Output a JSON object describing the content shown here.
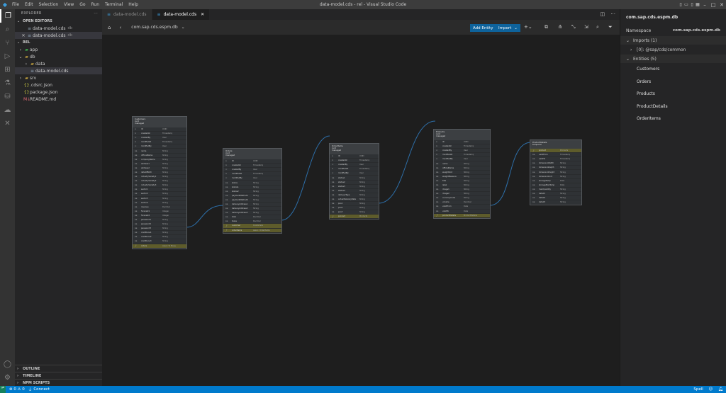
{
  "titlebar": {
    "menu": [
      "File",
      "Edit",
      "Selection",
      "View",
      "Go",
      "Run",
      "Terminal",
      "Help"
    ],
    "title": "data-model.cds - rel - Visual Studio Code"
  },
  "explorer": {
    "title": "EXPLORER",
    "open_editors": {
      "label": "OPEN EDITORS",
      "items": [
        {
          "name": "data-model.cds",
          "dir": "db"
        },
        {
          "name": "data-model.cds",
          "dir": "db"
        }
      ]
    },
    "workspace": {
      "label": "REL",
      "tree": [
        "app",
        "db",
        "data",
        "data-model.cds",
        "srv",
        ".cdsrc.json",
        "package.json",
        "README.md"
      ]
    },
    "bottom_sections": [
      "OUTLINE",
      "TIMELINE",
      "NPM SCRIPTS"
    ]
  },
  "tabs": [
    {
      "label": "data-model.cds",
      "active": false
    },
    {
      "label": "data-model.cds",
      "active": true
    }
  ],
  "toolbar": {
    "namespace": "com.sap.cds.espm.db",
    "add_entity": "Add Entity",
    "import": "Import"
  },
  "entities": [
    {
      "title": [
        "Customers",
        "cuid",
        "managed"
      ],
      "fields": [
        [
          "ID",
          "UUID"
        ],
        [
          "createdAt",
          "Timestamp"
        ],
        [
          "createdBy",
          "User"
        ],
        [
          "modifiedAt",
          "Timestamp"
        ],
        [
          "modifiedBy",
          "User"
        ],
        [
          "name",
          "String"
        ],
        [
          "officialName",
          "String"
        ],
        [
          "companyName",
          "String"
        ],
        [
          "address1",
          "String"
        ],
        [
          "address2",
          "String"
        ],
        [
          "dateOfBirth",
          "String"
        ],
        [
          "industryVariety1",
          "String"
        ],
        [
          "industryVariety2",
          "String"
        ],
        [
          "industryVariety3",
          "String"
        ],
        [
          "sector1",
          "String"
        ],
        [
          "sector2",
          "String"
        ],
        [
          "sector3",
          "String"
        ],
        [
          "sector4",
          "String"
        ],
        [
          "revenue",
          "Decimal"
        ],
        [
          "forecast1",
          "Integer"
        ],
        [
          "forecast2",
          "Integer"
        ],
        [
          "password1",
          "String"
        ],
        [
          "password2",
          "String"
        ],
        [
          "password3",
          "String"
        ],
        [
          "creditLine1",
          "String"
        ],
        [
          "creditLine2",
          "String"
        ],
        [
          "creditLine3",
          "String"
        ],
        [
          "orders",
          "Assoc.To Many"
        ]
      ]
    },
    {
      "title": [
        "Orders",
        "cuid",
        "managed"
      ],
      "fields": [
        [
          "ID",
          "UUID"
        ],
        [
          "createdAt",
          "Timestamp"
        ],
        [
          "createdBy",
          "User"
        ],
        [
          "modifiedAt",
          "Timestamp"
        ],
        [
          "modifiedBy",
          "User"
        ],
        [
          "status",
          "String"
        ],
        [
          "status1",
          "String"
        ],
        [
          "status2",
          "String"
        ],
        [
          "paymentMethod1",
          "String"
        ],
        [
          "paymentMethod2",
          "String"
        ],
        [
          "deliveryAddress1",
          "String"
        ],
        [
          "deliveryAddress2",
          "String"
        ],
        [
          "deliveryAddress3",
          "String"
        ],
        [
          "total",
          "Decimal"
        ],
        [
          "taxes",
          "Decimal"
        ],
        [
          "customer",
          "Customers"
        ],
        [
          "orderItems",
          "assoc. OrderItems"
        ]
      ]
    },
    {
      "title": [
        "OrderItems",
        "cuid",
        "managed"
      ],
      "fields": [
        [
          "ID",
          "UUID"
        ],
        [
          "createdAt",
          "Timestamp"
        ],
        [
          "createdBy",
          "User"
        ],
        [
          "modifiedAt",
          "Timestamp"
        ],
        [
          "modifiedBy",
          "User"
        ],
        [
          "status1",
          "String"
        ],
        [
          "status2",
          "String"
        ],
        [
          "status3",
          "String"
        ],
        [
          "status4",
          "String"
        ],
        [
          "deliveryType",
          "String"
        ],
        [
          "actualDeliveryDate",
          "String"
        ],
        [
          "pos1",
          "String"
        ],
        [
          "pos2",
          "String"
        ],
        [
          "pos3",
          "String"
        ],
        [
          "product",
          "Products"
        ]
      ]
    },
    {
      "title": [
        "Products",
        "cuid",
        "managed"
      ],
      "fields": [
        [
          "ID",
          "UUID"
        ],
        [
          "createdAt",
          "Timestamp"
        ],
        [
          "createdBy",
          "User"
        ],
        [
          "modifiedAt",
          "Timestamp"
        ],
        [
          "modifiedBy",
          "User"
        ],
        [
          "name",
          "String"
        ],
        [
          "officialName",
          "String"
        ],
        [
          "weightUnit",
          "String"
        ],
        [
          "weightMeasure",
          "String"
        ],
        [
          "title",
          "String"
        ],
        [
          "label",
          "String"
        ],
        [
          "image1",
          "String"
        ],
        [
          "image2",
          "String"
        ],
        [
          "currencyCode",
          "String"
        ],
        [
          "volume",
          "Decimal"
        ],
        [
          "validFrom",
          "Date"
        ],
        [
          "validTo",
          "Date"
        ],
        [
          "productDetails",
          "ProductDetails"
        ]
      ]
    },
    {
      "title": [
        "ProductDetails",
        "temporal"
      ],
      "fields": [
        [
          "product",
          "Products"
        ],
        [
          "validFrom",
          "Timestamp"
        ],
        [
          "validTo",
          "Timestamp"
        ],
        [
          "dimensionWidth",
          "String"
        ],
        [
          "dimensionDepth",
          "String"
        ],
        [
          "dimensionHeight",
          "String"
        ],
        [
          "dimensionUnit",
          "String"
        ],
        [
          "storageTemp",
          "Date"
        ],
        [
          "storageMaxTemp",
          "Date"
        ],
        [
          "maxQuantity",
          "String"
        ],
        [
          "detail1",
          "String"
        ],
        [
          "detail2",
          "String"
        ],
        [
          "detail3",
          "String"
        ]
      ]
    }
  ],
  "right_panel": {
    "title": "com.sap.cds.espm.db",
    "namespace_label": "Namespace",
    "namespace_value": "com.sap.cds.espm.db",
    "imports_label": "Imports (1)",
    "import_item": "[0]: @sap/cds/common",
    "entities_label": "Entities (5)",
    "entities": [
      "Customers",
      "Orders",
      "Products",
      "ProductDetails",
      "OrderItems"
    ]
  },
  "statusbar": {
    "problems": "⊗ 0 ⚠ 0",
    "connect": "Connect",
    "spell": "Spell"
  }
}
